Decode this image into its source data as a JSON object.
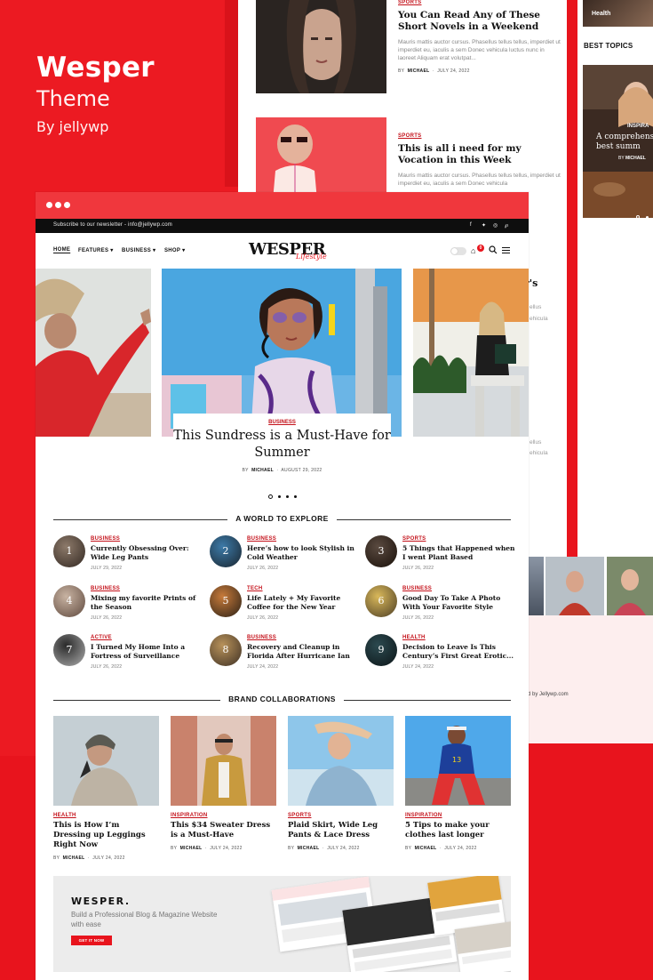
{
  "brand": {
    "name": "Wesper",
    "subtitle": "Theme",
    "author": "By jellywp"
  },
  "back_page": {
    "posts": [
      {
        "category": "SPORTS",
        "title": "You Can Read Any of These Short Novels in a Weekend",
        "excerpt": "Mauris mattis auctor cursus. Phasellus tellus tellus, imperdiet ut imperdiet eu, iaculis a sem Donec vehicula luctus nunc in laoreet Aliquam erat volutpat...",
        "byline_prefix": "BY",
        "author": "MICHAEL",
        "date": "JULY 24, 2022"
      },
      {
        "category": "SPORTS",
        "title": "This is all i need for my Vocation in this Week",
        "excerpt": "Mauris mattis auctor cursus. Phasellus tellus tellus, imperdiet ut imperdiet eu, iaculis a sem Donec vehicula",
        "byline_prefix": "BY",
        "author": "MICHAEL",
        "date": "JULY 24, 2022"
      }
    ],
    "fragments": {
      "title_tail": "r's",
      "text_a": "ellus",
      "text_b": "ehicula",
      "text_c": "ellus",
      "text_d": "ehicula"
    }
  },
  "sidebar": {
    "tag": "Health",
    "heading": "BEST TOPICS",
    "feature_category": "INSPIRA",
    "feature_title": "A comprehens the best summ",
    "feature_author": "MICHAEL",
    "feature_byline_prefix": "BY"
  },
  "footer_credit": "d by Jellywp.com",
  "site": {
    "topbar": "Subscribe to our newsletter - info@jellywp.com",
    "social": [
      "f",
      "t",
      "ig",
      "p"
    ],
    "nav": [
      "HOME",
      "FEATURES",
      "BUSINESS",
      "SHOP"
    ],
    "logo": "WESPER",
    "logo_swash": "Lifestyle",
    "cart_count": "0"
  },
  "hero": {
    "category": "BUSINESS",
    "title": "This Sundress is a Must-Have for Summer",
    "byline_prefix": "BY",
    "author": "MICHAEL",
    "date": "AUGUST 29, 2022"
  },
  "explore": {
    "heading": "A WORLD TO EXPLORE",
    "items": [
      {
        "num": "1",
        "category": "BUSINESS",
        "title": "Currently Obsessing Over: Wide Leg Pants",
        "date": "JULY 29, 2022"
      },
      {
        "num": "2",
        "category": "BUSINESS",
        "title": "Here’s how to look Stylish in Cold Weather",
        "date": "JULY 26, 2022"
      },
      {
        "num": "3",
        "category": "SPORTS",
        "title": "5 Things that Happened when I went Plant Based",
        "date": "JULY 26, 2022"
      },
      {
        "num": "4",
        "category": "BUSINESS",
        "title": "Mixing my favorite Prints of the Season",
        "date": "JULY 26, 2022"
      },
      {
        "num": "5",
        "category": "TECH",
        "title": "Life Lately + My Favorite Coffee for the New Year",
        "date": "JULY 26, 2022"
      },
      {
        "num": "6",
        "category": "BUSINESS",
        "title": "Good Day To Take A Photo With Your Favorite Style",
        "date": "JULY 26, 2022"
      },
      {
        "num": "7",
        "category": "ACTIVE",
        "title": "I Turned My Home Into a Fortress of Surveillance",
        "date": "JULY 26, 2022"
      },
      {
        "num": "8",
        "category": "BUSINESS",
        "title": "Recovery and Cleanup in Florida After Hurricane Ian",
        "date": "JULY 24, 2022"
      },
      {
        "num": "9",
        "category": "HEALTH",
        "title": "Decision to Leave Is This Century’s First Great Erotic...",
        "date": "JULY 24, 2022"
      }
    ]
  },
  "brand_collab": {
    "heading": "BRAND COLLABORATIONS",
    "items": [
      {
        "category": "HEALTH",
        "title": "This is How I’m Dressing up Leggings Right Now",
        "author": "MICHAEL",
        "date": "JULY 24, 2022"
      },
      {
        "category": "INSPIRATION",
        "title": "This $34 Sweater Dress is a Must-Have",
        "author": "MICHAEL",
        "date": "JULY 24, 2022"
      },
      {
        "category": "SPORTS",
        "title": "Plaid Skirt, Wide Leg Pants & Lace Dress",
        "author": "MICHAEL",
        "date": "JULY 24, 2022"
      },
      {
        "category": "INSPIRATION",
        "title": "5 Tips to make your clothes last longer",
        "author": "MICHAEL",
        "date": "JULY 24, 2022"
      }
    ],
    "byline_prefix": "BY"
  },
  "promo": {
    "logo": "WESPER.",
    "tagline": "Build a Professional Blog & Magazine Website with ease",
    "button": "GET IT NOW"
  },
  "colors": {
    "accent": "#e8141d",
    "chrome": "#f0373d",
    "category": "#c4111a",
    "topbar": "#0e0e0e"
  }
}
